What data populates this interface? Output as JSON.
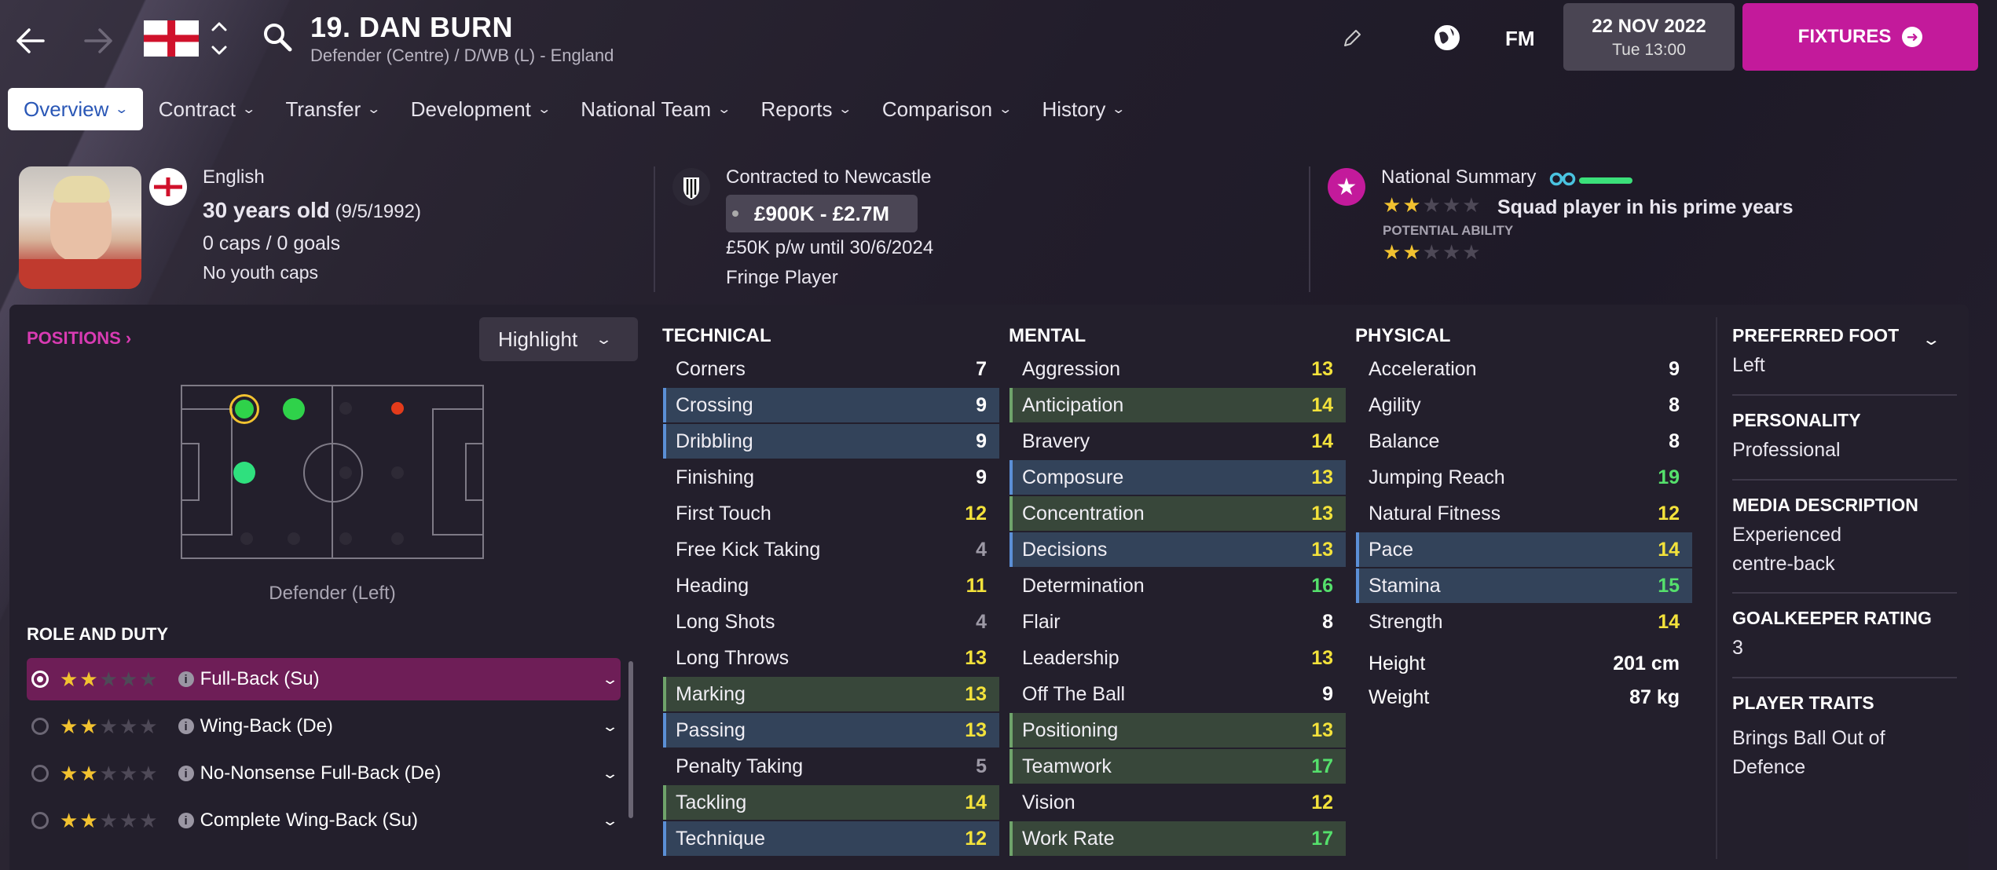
{
  "header": {
    "player_name": "19. DAN BURN",
    "player_sub": "Defender (Centre) / D/WB (L) - England",
    "date": "22 NOV 2022",
    "time": "Tue 13:00",
    "fm_label": "FM",
    "fixtures_label": "FIXTURES"
  },
  "tabs": [
    {
      "label": "Overview"
    },
    {
      "label": "Contract"
    },
    {
      "label": "Transfer"
    },
    {
      "label": "Development"
    },
    {
      "label": "National Team"
    },
    {
      "label": "Reports"
    },
    {
      "label": "Comparison"
    },
    {
      "label": "History"
    }
  ],
  "info": {
    "nationality": "English",
    "age": "30 years old",
    "dob": "(9/5/1992)",
    "caps": "0 caps / 0 goals",
    "youth_caps": "No youth caps",
    "contracted_to": "Contracted to Newcastle",
    "value": "£900K - £2.7M",
    "wage": "£50K p/w until 30/6/2024",
    "squad_status": "Fringe Player",
    "national_summary": "National Summary",
    "current_ability_stars": 2,
    "ability_text": "Squad player in his prime years",
    "potential_label": "POTENTIAL ABILITY",
    "potential_ability_stars": 2
  },
  "positions": {
    "title": "POSITIONS",
    "highlight_label": "Highlight",
    "caption": "Defender (Left)"
  },
  "role_duty": {
    "title": "ROLE AND DUTY",
    "roles": [
      {
        "label": "Full-Back (Su)",
        "stars": 2,
        "selected": true
      },
      {
        "label": "Wing-Back (De)",
        "stars": 2,
        "selected": false
      },
      {
        "label": "No-Nonsense Full-Back (De)",
        "stars": 2,
        "selected": false
      },
      {
        "label": "Complete Wing-Back (Su)",
        "stars": 2,
        "selected": false
      }
    ]
  },
  "attributes": {
    "technical_title": "TECHNICAL",
    "mental_title": "MENTAL",
    "physical_title": "PHYSICAL",
    "technical": [
      {
        "name": "Corners",
        "value": "7",
        "hl": ""
      },
      {
        "name": "Crossing",
        "value": "9",
        "hl": "blue"
      },
      {
        "name": "Dribbling",
        "value": "9",
        "hl": "blue"
      },
      {
        "name": "Finishing",
        "value": "9",
        "hl": ""
      },
      {
        "name": "First Touch",
        "value": "12",
        "hl": ""
      },
      {
        "name": "Free Kick Taking",
        "value": "4",
        "hl": ""
      },
      {
        "name": "Heading",
        "value": "11",
        "hl": ""
      },
      {
        "name": "Long Shots",
        "value": "4",
        "hl": ""
      },
      {
        "name": "Long Throws",
        "value": "13",
        "hl": ""
      },
      {
        "name": "Marking",
        "value": "13",
        "hl": "green"
      },
      {
        "name": "Passing",
        "value": "13",
        "hl": "blue"
      },
      {
        "name": "Penalty Taking",
        "value": "5",
        "hl": ""
      },
      {
        "name": "Tackling",
        "value": "14",
        "hl": "green"
      },
      {
        "name": "Technique",
        "value": "12",
        "hl": "blue"
      }
    ],
    "mental": [
      {
        "name": "Aggression",
        "value": "13",
        "hl": ""
      },
      {
        "name": "Anticipation",
        "value": "14",
        "hl": "green"
      },
      {
        "name": "Bravery",
        "value": "14",
        "hl": ""
      },
      {
        "name": "Composure",
        "value": "13",
        "hl": "blue"
      },
      {
        "name": "Concentration",
        "value": "13",
        "hl": "green"
      },
      {
        "name": "Decisions",
        "value": "13",
        "hl": "blue"
      },
      {
        "name": "Determination",
        "value": "16",
        "hl": ""
      },
      {
        "name": "Flair",
        "value": "8",
        "hl": ""
      },
      {
        "name": "Leadership",
        "value": "13",
        "hl": ""
      },
      {
        "name": "Off The Ball",
        "value": "9",
        "hl": ""
      },
      {
        "name": "Positioning",
        "value": "13",
        "hl": "green"
      },
      {
        "name": "Teamwork",
        "value": "17",
        "hl": "green"
      },
      {
        "name": "Vision",
        "value": "12",
        "hl": ""
      },
      {
        "name": "Work Rate",
        "value": "17",
        "hl": "green"
      }
    ],
    "physical": [
      {
        "name": "Acceleration",
        "value": "9",
        "hl": ""
      },
      {
        "name": "Agility",
        "value": "8",
        "hl": ""
      },
      {
        "name": "Balance",
        "value": "8",
        "hl": ""
      },
      {
        "name": "Jumping Reach",
        "value": "19",
        "hl": ""
      },
      {
        "name": "Natural Fitness",
        "value": "12",
        "hl": ""
      },
      {
        "name": "Pace",
        "value": "14",
        "hl": "blue"
      },
      {
        "name": "Stamina",
        "value": "15",
        "hl": "blue"
      },
      {
        "name": "Strength",
        "value": "14",
        "hl": ""
      }
    ],
    "height_label": "Height",
    "height_value": "201 cm",
    "weight_label": "Weight",
    "weight_value": "87 kg"
  },
  "details": {
    "preferred_foot_title": "PREFERRED FOOT",
    "preferred_foot": "Left",
    "personality_title": "PERSONALITY",
    "personality": "Professional",
    "media_title": "MEDIA DESCRIPTION",
    "media": "Experienced centre-back",
    "gk_title": "GOALKEEPER RATING",
    "gk": "3",
    "traits_title": "PLAYER TRAITS",
    "traits": "Brings Ball Out of Defence"
  },
  "colors": {
    "accent": "#c31a9b",
    "positions_pink": "#d93bb3",
    "attr_yellow": "#f3e23b",
    "attr_green": "#55e06c",
    "attr_grey": "#9d99a6"
  },
  "icons": [
    "back-arrow-icon",
    "forward-arrow-icon",
    "england-flag-icon",
    "sort-arrows-icon",
    "search-icon",
    "pencil-icon",
    "globe-icon",
    "fm-logo",
    "chevron-down-icon",
    "newcastle-crest-icon",
    "star-badge-icon",
    "binoculars-icon",
    "info-icon"
  ]
}
